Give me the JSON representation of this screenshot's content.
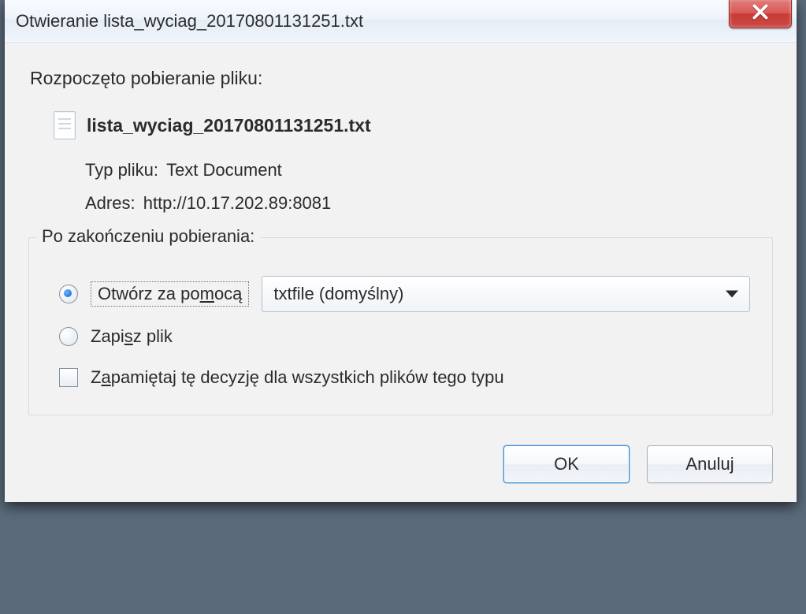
{
  "titlebar": {
    "title": "Otwieranie lista_wyciag_20170801131251.txt"
  },
  "intro_text": "Rozpoczęto pobieranie pliku:",
  "file": {
    "name": "lista_wyciag_20170801131251.txt",
    "type_label": "Typ pliku:",
    "type_value": "Text Document",
    "from_label": "Adres:",
    "from_value": "http://10.17.202.89:8081"
  },
  "group": {
    "title": "Po zakończeniu pobierania:",
    "open_with_prefix": "Otwórz za po",
    "open_with_underline": "m",
    "open_with_suffix": "ocą",
    "app_selected": "txtfile (domyślny)",
    "save_prefix": "Zapi",
    "save_underline": "s",
    "save_suffix": "z plik",
    "remember_prefix": "Z",
    "remember_underline": "a",
    "remember_suffix": "pamiętaj tę decyzję dla wszystkich plików tego typu"
  },
  "buttons": {
    "ok": "OK",
    "cancel": "Anuluj"
  }
}
